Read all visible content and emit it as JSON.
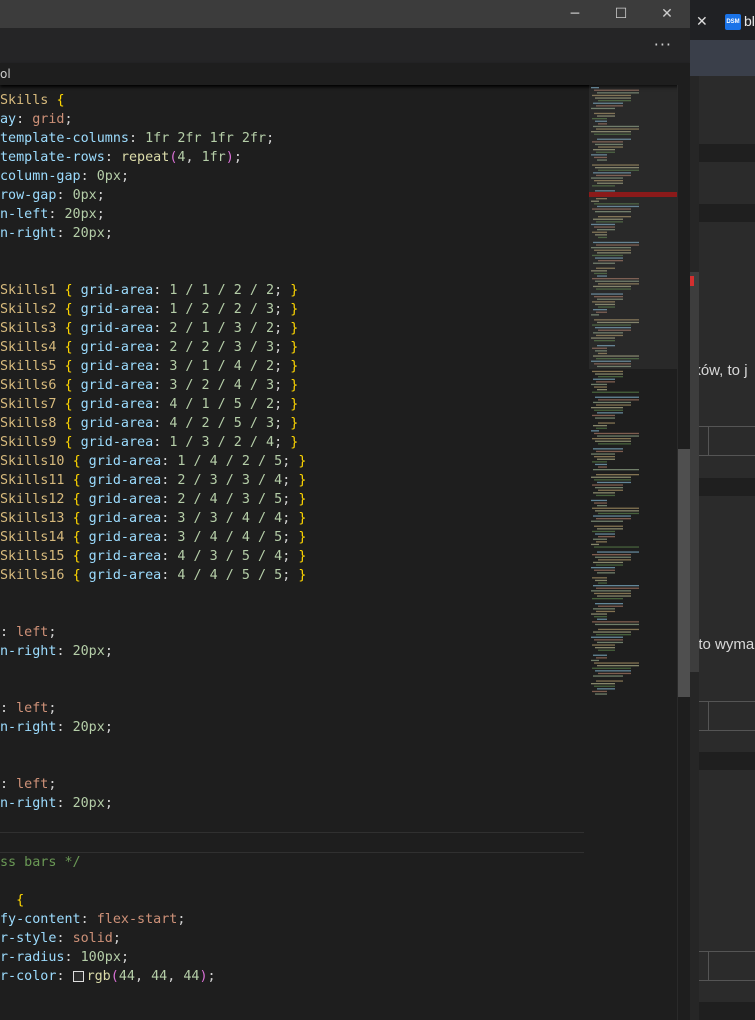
{
  "editor": {
    "window_controls": {
      "minimize": "─",
      "maximize": "☐",
      "close": "✕"
    },
    "more_actions": "···",
    "breadcrumb": "ol"
  },
  "code_lines": [
    [
      [
        "sel",
        "Skills "
      ],
      [
        "br",
        "{"
      ]
    ],
    [
      [
        "prop",
        "ay"
      ],
      [
        "pun",
        ": "
      ],
      [
        "val",
        "grid"
      ],
      [
        "pun",
        ";"
      ]
    ],
    [
      [
        "prop",
        "template-columns"
      ],
      [
        "pun",
        ": "
      ],
      [
        "num",
        "1fr 2fr 1fr 2fr"
      ],
      [
        "pun",
        ";"
      ]
    ],
    [
      [
        "prop",
        "template-rows"
      ],
      [
        "pun",
        ": "
      ],
      [
        "fn",
        "repeat"
      ],
      [
        "br2",
        "("
      ],
      [
        "num",
        "4"
      ],
      [
        "pun",
        ", "
      ],
      [
        "num",
        "1fr"
      ],
      [
        "br2",
        ")"
      ],
      [
        "pun",
        ";"
      ]
    ],
    [
      [
        "prop",
        "column-gap"
      ],
      [
        "pun",
        ": "
      ],
      [
        "num",
        "0px"
      ],
      [
        "pun",
        ";"
      ]
    ],
    [
      [
        "prop",
        "row-gap"
      ],
      [
        "pun",
        ": "
      ],
      [
        "num",
        "0px"
      ],
      [
        "pun",
        ";"
      ]
    ],
    [
      [
        "prop",
        "n-left"
      ],
      [
        "pun",
        ": "
      ],
      [
        "num",
        "20px"
      ],
      [
        "pun",
        ";"
      ]
    ],
    [
      [
        "prop",
        "n-right"
      ],
      [
        "pun",
        ": "
      ],
      [
        "num",
        "20px"
      ],
      [
        "pun",
        ";"
      ]
    ],
    [],
    [],
    [
      [
        "sel",
        "Skills1 "
      ],
      [
        "br",
        "{"
      ],
      [
        "prop",
        " grid-area"
      ],
      [
        "pun",
        ": "
      ],
      [
        "num",
        "1 / 1 / 2 / 2"
      ],
      [
        "pun",
        "; "
      ],
      [
        "br",
        "}"
      ]
    ],
    [
      [
        "sel",
        "Skills2 "
      ],
      [
        "br",
        "{"
      ],
      [
        "prop",
        " grid-area"
      ],
      [
        "pun",
        ": "
      ],
      [
        "num",
        "1 / 2 / 2 / 3"
      ],
      [
        "pun",
        "; "
      ],
      [
        "br",
        "}"
      ]
    ],
    [
      [
        "sel",
        "Skills3 "
      ],
      [
        "br",
        "{"
      ],
      [
        "prop",
        " grid-area"
      ],
      [
        "pun",
        ": "
      ],
      [
        "num",
        "2 / 1 / 3 / 2"
      ],
      [
        "pun",
        "; "
      ],
      [
        "br",
        "}"
      ]
    ],
    [
      [
        "sel",
        "Skills4 "
      ],
      [
        "br",
        "{"
      ],
      [
        "prop",
        " grid-area"
      ],
      [
        "pun",
        ": "
      ],
      [
        "num",
        "2 / 2 / 3 / 3"
      ],
      [
        "pun",
        "; "
      ],
      [
        "br",
        "}"
      ]
    ],
    [
      [
        "sel",
        "Skills5 "
      ],
      [
        "br",
        "{"
      ],
      [
        "prop",
        " grid-area"
      ],
      [
        "pun",
        ": "
      ],
      [
        "num",
        "3 / 1 / 4 / 2"
      ],
      [
        "pun",
        "; "
      ],
      [
        "br",
        "}"
      ]
    ],
    [
      [
        "sel",
        "Skills6 "
      ],
      [
        "br",
        "{"
      ],
      [
        "prop",
        " grid-area"
      ],
      [
        "pun",
        ": "
      ],
      [
        "num",
        "3 / 2 / 4 / 3"
      ],
      [
        "pun",
        "; "
      ],
      [
        "br",
        "}"
      ]
    ],
    [
      [
        "sel",
        "Skills7 "
      ],
      [
        "br",
        "{"
      ],
      [
        "prop",
        " grid-area"
      ],
      [
        "pun",
        ": "
      ],
      [
        "num",
        "4 / 1 / 5 / 2"
      ],
      [
        "pun",
        "; "
      ],
      [
        "br",
        "}"
      ]
    ],
    [
      [
        "sel",
        "Skills8 "
      ],
      [
        "br",
        "{"
      ],
      [
        "prop",
        " grid-area"
      ],
      [
        "pun",
        ": "
      ],
      [
        "num",
        "4 / 2 / 5 / 3"
      ],
      [
        "pun",
        "; "
      ],
      [
        "br",
        "}"
      ]
    ],
    [
      [
        "sel",
        "Skills9 "
      ],
      [
        "br",
        "{"
      ],
      [
        "prop",
        " grid-area"
      ],
      [
        "pun",
        ": "
      ],
      [
        "num",
        "1 / 3 / 2 / 4"
      ],
      [
        "pun",
        "; "
      ],
      [
        "br",
        "}"
      ]
    ],
    [
      [
        "sel",
        "Skills10 "
      ],
      [
        "br",
        "{"
      ],
      [
        "prop",
        " grid-area"
      ],
      [
        "pun",
        ": "
      ],
      [
        "num",
        "1 / 4 / 2 / 5"
      ],
      [
        "pun",
        "; "
      ],
      [
        "br",
        "}"
      ]
    ],
    [
      [
        "sel",
        "Skills11 "
      ],
      [
        "br",
        "{"
      ],
      [
        "prop",
        " grid-area"
      ],
      [
        "pun",
        ": "
      ],
      [
        "num",
        "2 / 3 / 3 / 4"
      ],
      [
        "pun",
        "; "
      ],
      [
        "br",
        "}"
      ]
    ],
    [
      [
        "sel",
        "Skills12 "
      ],
      [
        "br",
        "{"
      ],
      [
        "prop",
        " grid-area"
      ],
      [
        "pun",
        ": "
      ],
      [
        "num",
        "2 / 4 / 3 / 5"
      ],
      [
        "pun",
        "; "
      ],
      [
        "br",
        "}"
      ]
    ],
    [
      [
        "sel",
        "Skills13 "
      ],
      [
        "br",
        "{"
      ],
      [
        "prop",
        " grid-area"
      ],
      [
        "pun",
        ": "
      ],
      [
        "num",
        "3 / 3 / 4 / 4"
      ],
      [
        "pun",
        "; "
      ],
      [
        "br",
        "}"
      ]
    ],
    [
      [
        "sel",
        "Skills14 "
      ],
      [
        "br",
        "{"
      ],
      [
        "prop",
        " grid-area"
      ],
      [
        "pun",
        ": "
      ],
      [
        "num",
        "3 / 4 / 4 / 5"
      ],
      [
        "pun",
        "; "
      ],
      [
        "br",
        "}"
      ]
    ],
    [
      [
        "sel",
        "Skills15 "
      ],
      [
        "br",
        "{"
      ],
      [
        "prop",
        " grid-area"
      ],
      [
        "pun",
        ": "
      ],
      [
        "num",
        "4 / 3 / 5 / 4"
      ],
      [
        "pun",
        "; "
      ],
      [
        "br",
        "}"
      ]
    ],
    [
      [
        "sel",
        "Skills16 "
      ],
      [
        "br",
        "{"
      ],
      [
        "prop",
        " grid-area"
      ],
      [
        "pun",
        ": "
      ],
      [
        "num",
        "4 / 4 / 5 / 5"
      ],
      [
        "pun",
        "; "
      ],
      [
        "br",
        "}"
      ]
    ],
    [],
    [],
    [
      [
        "pun",
        ": "
      ],
      [
        "val",
        "left"
      ],
      [
        "pun",
        ";"
      ]
    ],
    [
      [
        "prop",
        "n-right"
      ],
      [
        "pun",
        ": "
      ],
      [
        "num",
        "20px"
      ],
      [
        "pun",
        ";"
      ]
    ],
    [],
    [],
    [
      [
        "pun",
        ": "
      ],
      [
        "val",
        "left"
      ],
      [
        "pun",
        ";"
      ]
    ],
    [
      [
        "prop",
        "n-right"
      ],
      [
        "pun",
        ": "
      ],
      [
        "num",
        "20px"
      ],
      [
        "pun",
        ";"
      ]
    ],
    [],
    [],
    [
      [
        "pun",
        ": "
      ],
      [
        "val",
        "left"
      ],
      [
        "pun",
        ";"
      ]
    ],
    [
      [
        "prop",
        "n-right"
      ],
      [
        "pun",
        ": "
      ],
      [
        "num",
        "20px"
      ],
      [
        "pun",
        ";"
      ]
    ],
    [],
    [],
    [
      [
        "cm",
        "ss bars */"
      ]
    ],
    [],
    [
      [
        "pun",
        "  "
      ],
      [
        "br",
        "{"
      ]
    ],
    [
      [
        "prop",
        "fy-content"
      ],
      [
        "pun",
        ": "
      ],
      [
        "val",
        "flex-start"
      ],
      [
        "pun",
        ";"
      ]
    ],
    [
      [
        "prop",
        "r-style"
      ],
      [
        "pun",
        ": "
      ],
      [
        "val",
        "solid"
      ],
      [
        "pun",
        ";"
      ]
    ],
    [
      [
        "prop",
        "r-radius"
      ],
      [
        "pun",
        ": "
      ],
      [
        "num",
        "100px"
      ],
      [
        "pun",
        ";"
      ]
    ],
    [
      [
        "prop",
        "r-color"
      ],
      [
        "pun",
        ": "
      ],
      [
        "swatch",
        ""
      ],
      [
        "fn",
        "rgb"
      ],
      [
        "br2",
        "("
      ],
      [
        "num",
        "44"
      ],
      [
        "pun",
        ", "
      ],
      [
        "num",
        "44"
      ],
      [
        "pun",
        ", "
      ],
      [
        "num",
        "44"
      ],
      [
        "br2",
        ")"
      ],
      [
        "pun",
        ";"
      ]
    ]
  ],
  "current_line_index": 39,
  "browser": {
    "tab_close": "✕",
    "favicon_text": "DSM",
    "tab_title": "bl",
    "snippet_1": "ików, to j",
    "snippet_2": ", to wyma"
  }
}
